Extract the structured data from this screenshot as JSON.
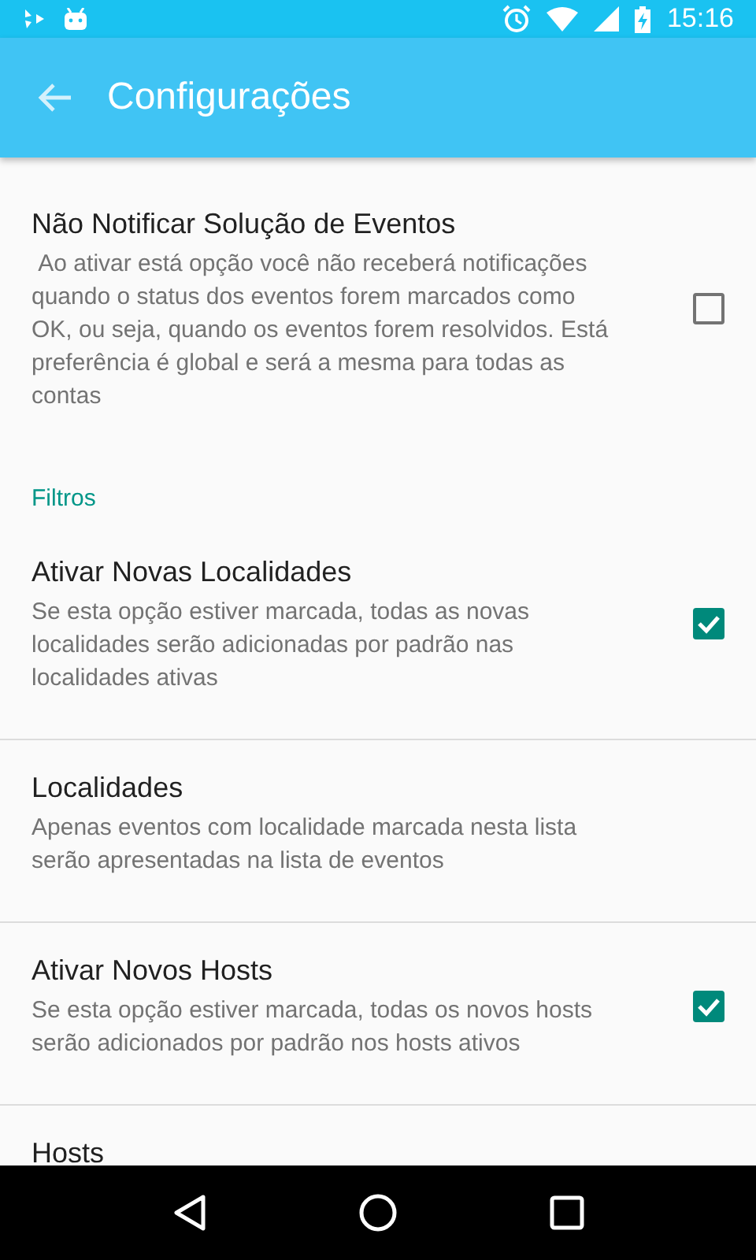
{
  "status_bar": {
    "time": "15:16"
  },
  "app_bar": {
    "title": "Configurações"
  },
  "sections": [
    {
      "items": [
        {
          "kind": "checkbox",
          "title": "Não Notificar Solução de Eventos",
          "summary": " Ao ativar está opção você não receberá notificações quando o status dos eventos forem marcados como OK, ou seja, quando os eventos forem resolvidos. Está preferência é global e será a mesma para todas as contas",
          "checked": false
        }
      ]
    },
    {
      "header": "Filtros",
      "items": [
        {
          "kind": "checkbox",
          "title": "Ativar Novas Localidades",
          "summary": "Se esta opção estiver marcada, todas as novas localidades serão adicionadas por padrão nas localidades ativas",
          "checked": true
        },
        {
          "kind": "plain",
          "title": "Localidades",
          "summary": "Apenas eventos com localidade marcada nesta lista serão apresentadas na lista de eventos"
        },
        {
          "kind": "checkbox",
          "title": "Ativar Novos Hosts",
          "summary": "Se esta opção estiver marcada, todas os novos hosts serão adicionados por padrão nos hosts ativos",
          "checked": true
        },
        {
          "kind": "plain",
          "title": "Hosts"
        }
      ]
    }
  ]
}
